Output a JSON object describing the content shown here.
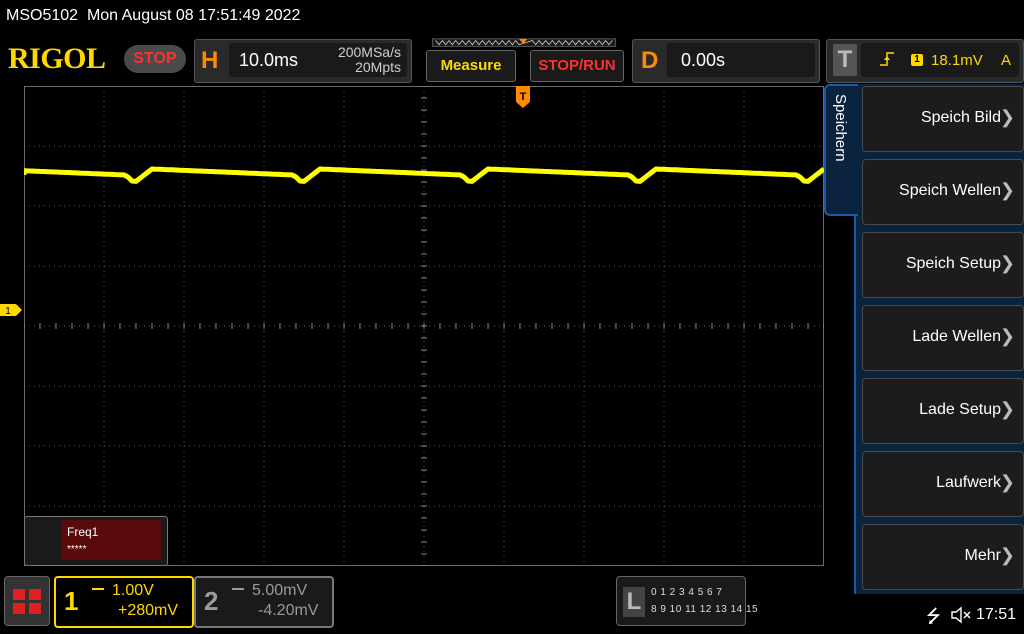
{
  "title_bar": {
    "model": "MSO5102",
    "datetime": "Mon August 08 17:51:49 2022"
  },
  "header": {
    "logo": "RIGOL",
    "run_state": "STOP",
    "horizontal": {
      "letter": "H",
      "timebase": "10.0ms",
      "sample_rate": "200MSa/s",
      "memory_depth": "20Mpts"
    },
    "measure_label": "Measure",
    "stop_run_label": "STOP/RUN",
    "delay": {
      "letter": "D",
      "value": "0.00s"
    },
    "trigger": {
      "letter": "T",
      "source": "1",
      "level": "18.1mV",
      "mode": "A"
    }
  },
  "waveform": {
    "channel": "1",
    "color": "#ffff00"
  },
  "measurement": {
    "name": "Freq1",
    "value": "*****"
  },
  "menu": {
    "tab_label": "Speichern",
    "items": [
      {
        "label": "Speich Bild"
      },
      {
        "label": "Speich Wellen"
      },
      {
        "label": "Speich Setup"
      },
      {
        "label": "Lade Wellen"
      },
      {
        "label": "Lade Setup"
      },
      {
        "label": "Laufwerk"
      },
      {
        "label": "Mehr"
      }
    ]
  },
  "channels": [
    {
      "number": "1",
      "scale": "1.00V",
      "offset": "+280mV",
      "color": "#ffd800"
    },
    {
      "number": "2",
      "scale": "5.00mV",
      "offset": "-4.20mV",
      "color": "#9a9a9a"
    }
  ],
  "logic_analyzer": {
    "letter": "L",
    "row1": "0 1 2 3   4 5 6 7",
    "row2": "8 9 10 11  12 13 14 15"
  },
  "status": {
    "time": "17:51",
    "usb_icon": "usb-icon",
    "speaker_icon": "speaker-muted-icon"
  }
}
